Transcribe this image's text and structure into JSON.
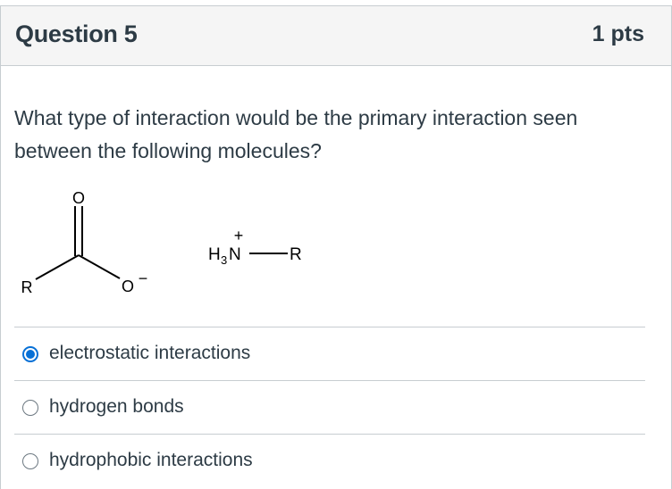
{
  "question": {
    "title": "Question 5",
    "points": "1 pts",
    "prompt": "What type of interaction would be the primary interaction seen between the following molecules?"
  },
  "figure": {
    "carboxylate": {
      "oxygen_top": "O",
      "r_group": "R",
      "oxygen_anion": "O",
      "charge": "−"
    },
    "ammonium": {
      "h": "H",
      "subscript": "3",
      "n": "N",
      "charge": "+",
      "r_group": "R"
    }
  },
  "answers": [
    {
      "label": "electrostatic interactions",
      "selected": true
    },
    {
      "label": "hydrogen bonds",
      "selected": false
    },
    {
      "label": "hydrophobic interactions",
      "selected": false
    }
  ],
  "colors": {
    "accent": "#0770d6",
    "header_bg": "#f5f5f5",
    "border": "#c7cdd1",
    "text": "#2d3b45"
  }
}
